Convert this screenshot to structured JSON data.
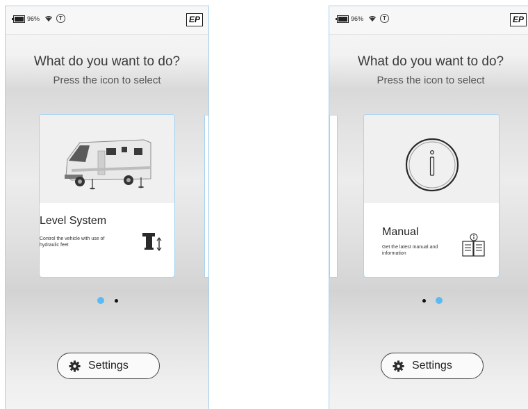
{
  "status": {
    "battery_pct": "96%",
    "t_icon_label": "T",
    "logo": "EP"
  },
  "header": {
    "title": "What do you want to do?",
    "subtitle": "Press the icon to select"
  },
  "screens": [
    {
      "card": {
        "title": "Level System",
        "description": "Control the vehicle with use of hydraulic feet",
        "image": "motorhome-image",
        "icon": "hydraulic-foot-icon"
      },
      "active_page": 1,
      "page_count": 2
    },
    {
      "card": {
        "title": "Manual",
        "description": "Get the latest manual and information",
        "image": "info-circle-icon",
        "icon": "manual-book-icon"
      },
      "active_page": 2,
      "page_count": 2
    }
  ],
  "settings": {
    "label": "Settings",
    "icon": "gear-icon"
  },
  "colors": {
    "accent": "#5bbaf0",
    "card_border": "#a9d3ef",
    "inactive_dot": "#111111"
  }
}
